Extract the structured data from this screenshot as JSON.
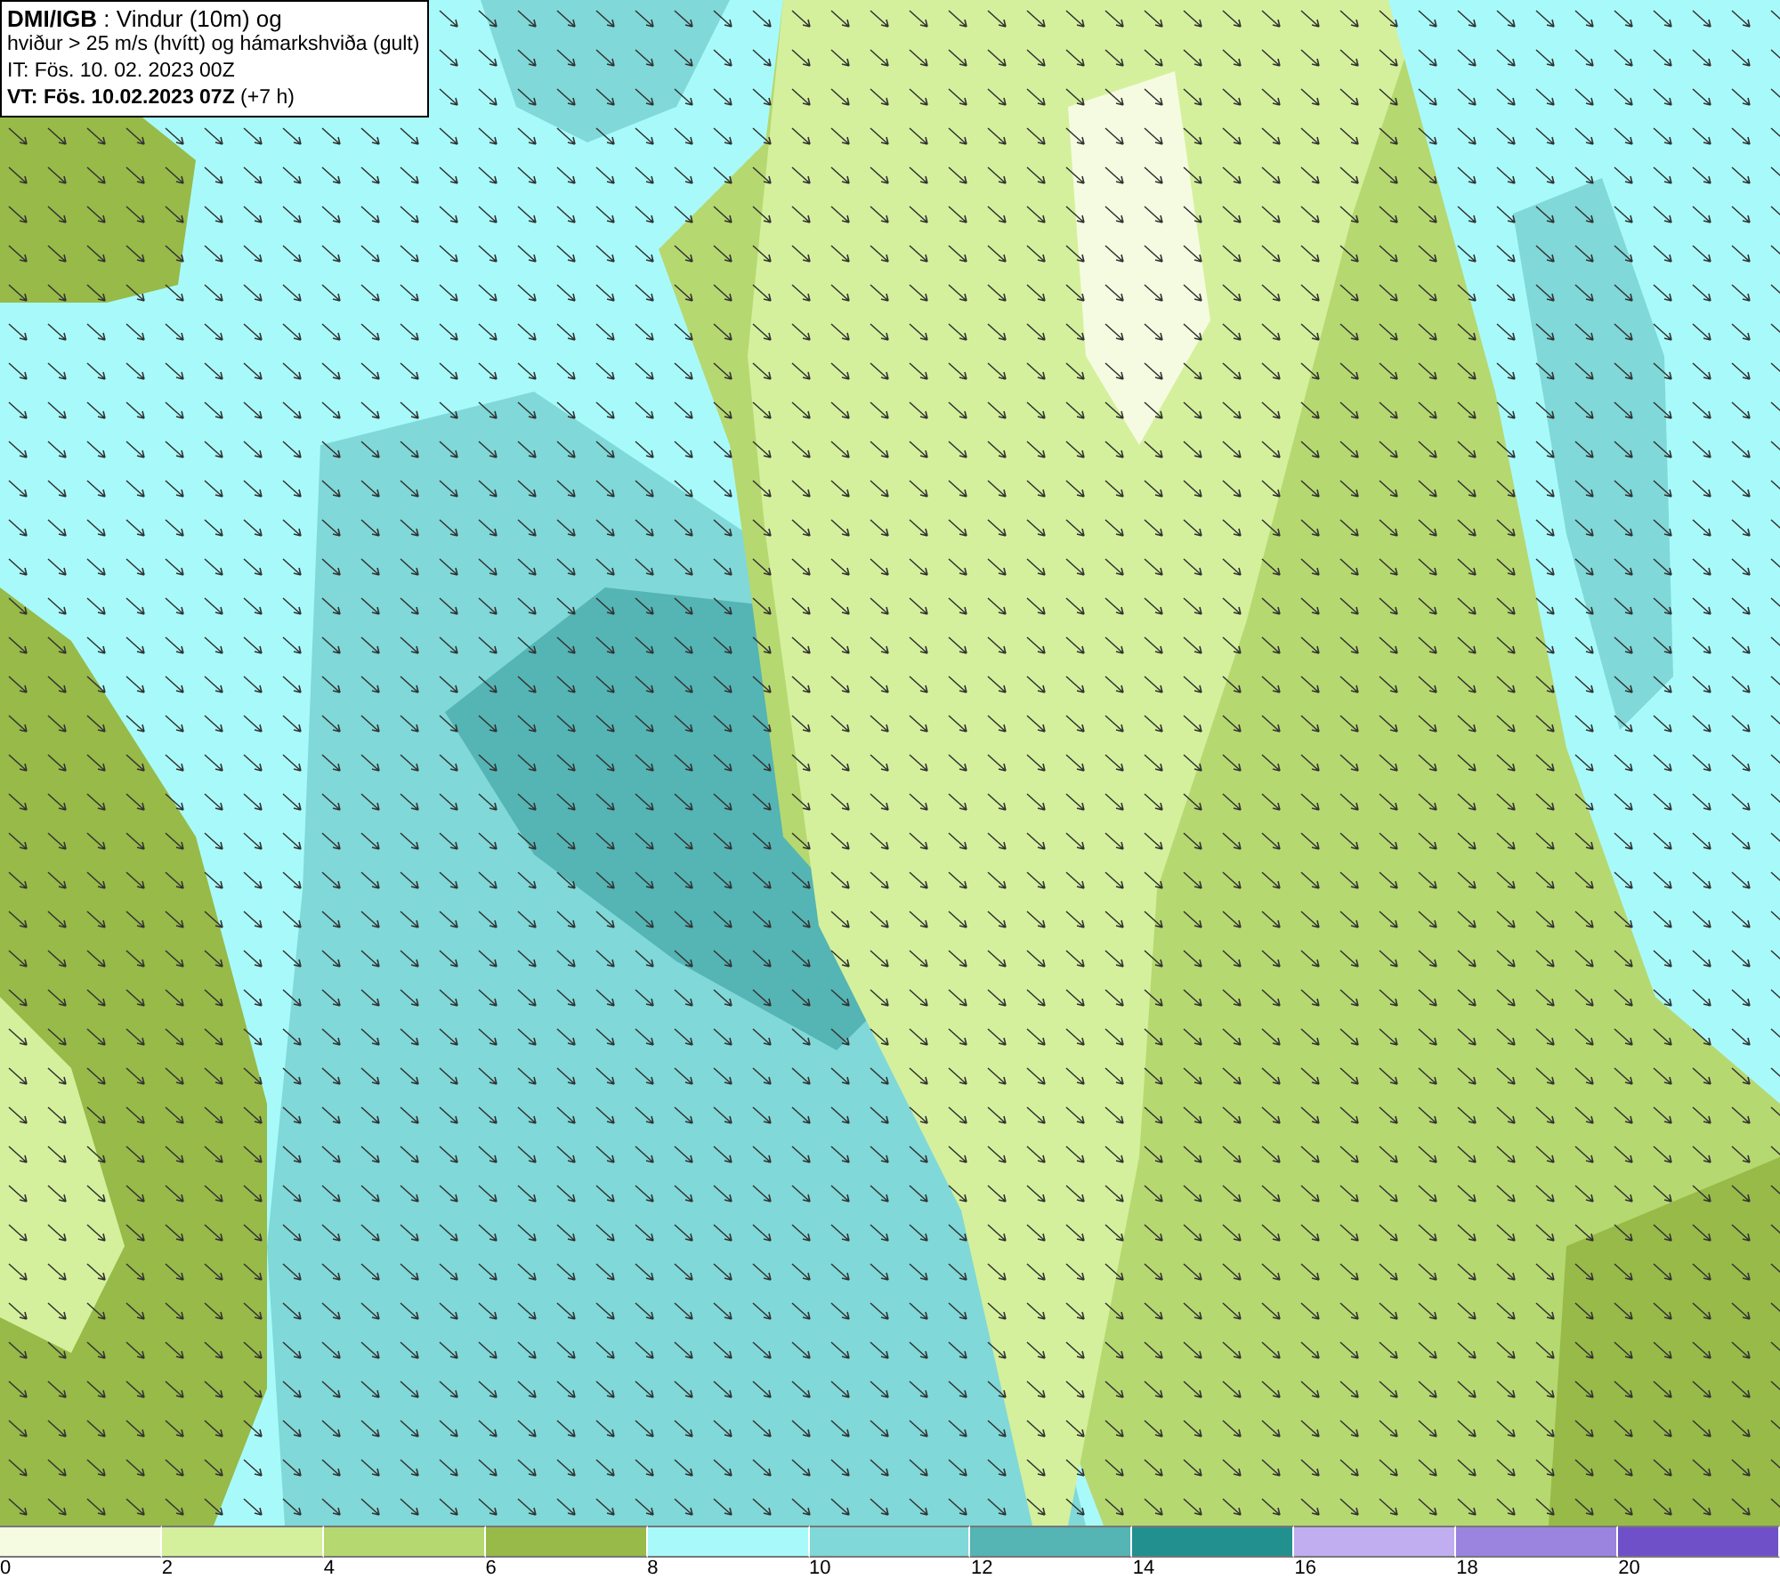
{
  "title_box": {
    "lines": [
      "**DMI/IGB** : Vindur (10m) og",
      "hviður > 25 m/s (hvítt) og hámarkshviða (gult)",
      "IT: Fös. 10. 02. 2023 00Z",
      "**VT: Fös. 10.02.2023 07Z** (+7 h)"
    ]
  },
  "legend": {
    "bins": [
      {
        "color": "#f5fbe0",
        "label": "0"
      },
      {
        "color": "#d4f09c",
        "label": "2"
      },
      {
        "color": "#b6d870",
        "label": "4"
      },
      {
        "color": "#97ba48",
        "label": "6"
      },
      {
        "color": "#a8fafa",
        "label": "8"
      },
      {
        "color": "#80d8d8",
        "label": "10"
      },
      {
        "color": "#55b4b4",
        "label": "12"
      },
      {
        "color": "#239090",
        "label": "14"
      },
      {
        "color": "#c0aef0",
        "label": "16"
      },
      {
        "color": "#9a84e0",
        "label": "18"
      },
      {
        "color": "#7050c8",
        "label": "20"
      }
    ]
  }
}
